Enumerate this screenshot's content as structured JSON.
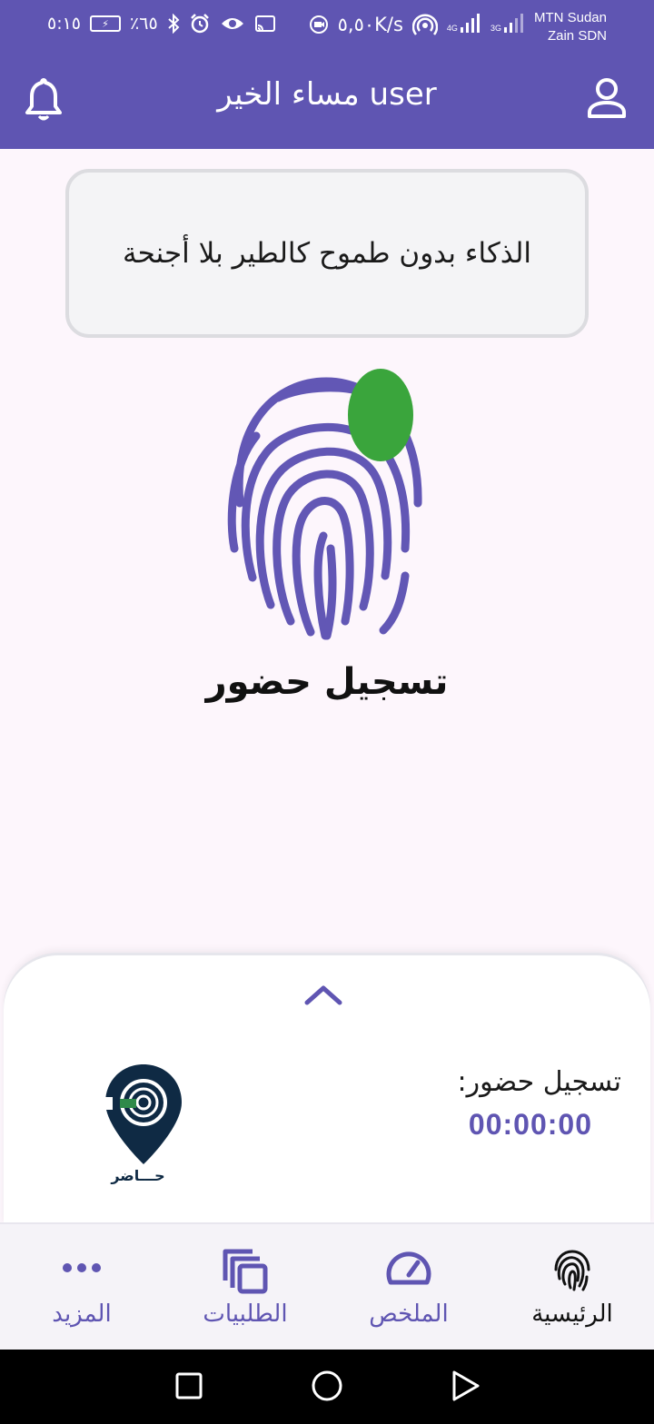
{
  "status_bar": {
    "time": "٥:١٥",
    "battery_percent": "٪٦٥",
    "net_speed": "٥,٥٠K/s",
    "carrier_1": "MTN Sudan",
    "carrier_2": "Zain SDN",
    "net_4g": "4G",
    "net_3g": "3G"
  },
  "header": {
    "title": "مساء الخير user",
    "bell_icon": "bell-icon",
    "profile_icon": "person-icon"
  },
  "quote": {
    "text": "الذكاء بدون طموح كالطير بلا أجنحة"
  },
  "main": {
    "fingerprint_icon": "fingerprint-icon",
    "status_color": "#3aa53c",
    "action_label": "تسجيل حضور"
  },
  "sheet": {
    "title": "تسجيل حضور:",
    "timer": "00:00:00",
    "logo_text": "حـــاضر"
  },
  "nav": {
    "items": [
      {
        "label": "الرئيسية",
        "icon": "fingerprint-icon",
        "active": true
      },
      {
        "label": "الملخص",
        "icon": "speedometer-icon",
        "active": false
      },
      {
        "label": "الطلبيات",
        "icon": "copy-icon",
        "active": false
      },
      {
        "label": "المزيد",
        "icon": "more-icon",
        "active": false
      }
    ]
  },
  "colors": {
    "primary": "#5f55b2",
    "success": "#3aa53c"
  }
}
